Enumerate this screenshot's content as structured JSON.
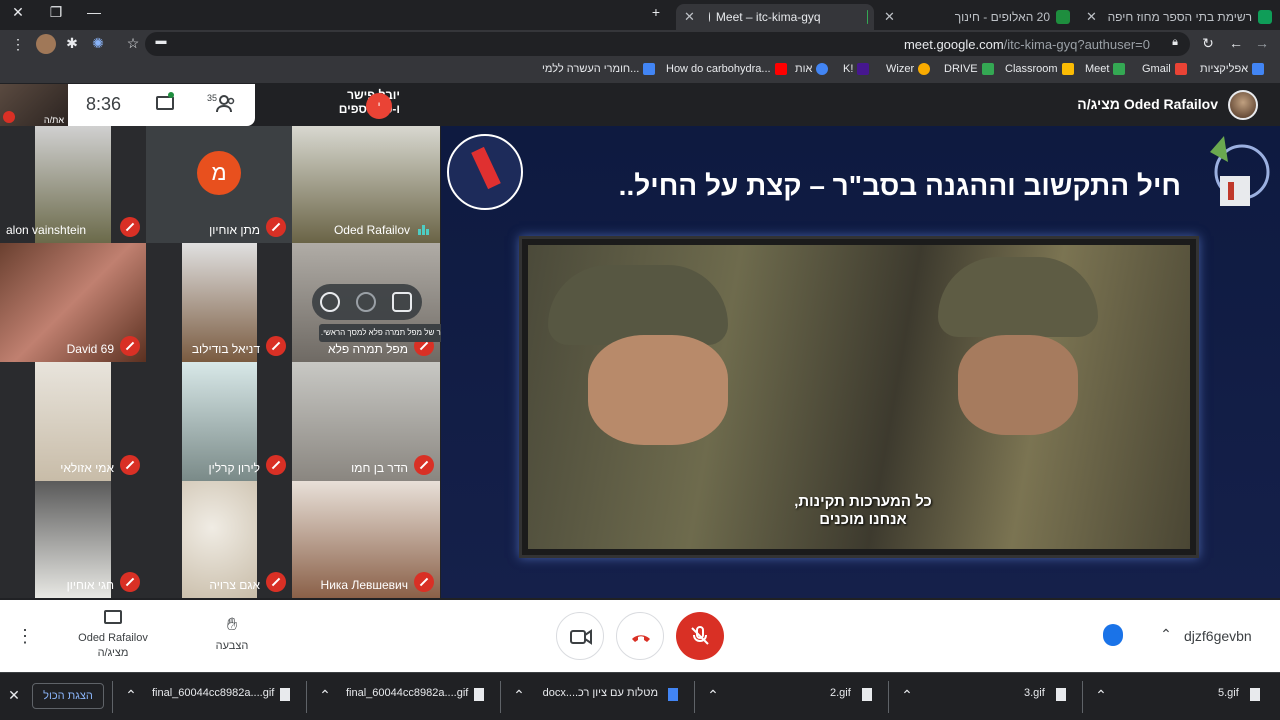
{
  "browser": {
    "tabs": [
      {
        "label": "Meet – itc-kima-gyq",
        "active": true
      },
      {
        "label": "20 האלופים - חינוך"
      },
      {
        "label": "רשימת בתי הספר מחוז חיפה תח"
      }
    ],
    "url_host": "meet.google.com",
    "url_path": "/itc-kima-gyq?authuser=0",
    "bookmarks": [
      "אפליקציות",
      "Gmail",
      "Meet",
      "Classroom",
      "DRIVE",
      "Wizer",
      "K!",
      "אות",
      "How do carbohydra...",
      "חומרי העשרה ללמי..."
    ]
  },
  "meet": {
    "self_name": "את/ה",
    "clock": "8:36",
    "participant_count": "35",
    "presenter_pill": {
      "name": "יובל פישר",
      "sub": "ו-20 נוספים"
    },
    "presenting_label": "Oded Rafailov מציג/ה",
    "tiles": [
      {
        "name": "alon vainshtein"
      },
      {
        "name": "מתן אוחיון",
        "initial": "מ"
      },
      {
        "name": "Oded Rafailov"
      },
      {
        "name": "David 69"
      },
      {
        "name": "דניאל בודילוב"
      },
      {
        "name": "מפל תמרה פלא"
      },
      {
        "name": "אמי אזולאי"
      },
      {
        "name": "לירון קרלין"
      },
      {
        "name": "הדר בן חמו"
      },
      {
        "name": "חגי אוחיון"
      },
      {
        "name": "אגם צרויה"
      },
      {
        "name": "Ника Левшевич"
      }
    ],
    "tooltip": "הצמדת השידור של מפל תמרה פלא למסך הראשי.",
    "presentation": {
      "title": "חיל התקשוב וההגנה בסב\"ר – קצת על החיל..",
      "subtitle_line1": "כל המערכות תקינות,",
      "subtitle_line2": "אנחנו מוכנים"
    },
    "controls": {
      "presenting_name": "Oded Rafailov",
      "presenting_role": "מציג/ה",
      "raise_hand": "הצבעה",
      "meeting_code": "djzf6gevbn"
    }
  },
  "downloads": {
    "show_all": "הצגת הכול",
    "files": [
      "final_60044cc8982a....gif",
      "final_60044cc8982a....gif",
      "מטלות עם ציון רכ....docx",
      "2.gif",
      "3.gif",
      "5.gif"
    ]
  },
  "colors": {
    "accent_red": "#d93025",
    "accent_blue": "#1a73e8",
    "avatar_orange": "#e8501e"
  }
}
